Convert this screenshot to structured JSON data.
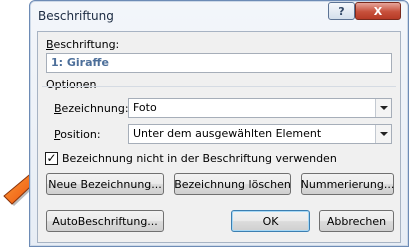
{
  "window": {
    "title": "Beschriftung",
    "help_label": "?",
    "close_label": "X"
  },
  "caption": {
    "label": "Beschriftung:",
    "value": "1: Giraffe"
  },
  "options": {
    "group_label": "Optionen",
    "bezeichnung": {
      "label": "Bezeichnung:",
      "value": "Foto"
    },
    "position": {
      "label": "Position:",
      "value": "Unter dem ausgewählten Element"
    },
    "exclude_label": {
      "label": "Bezeichnung nicht in der Beschriftung verwenden",
      "checked": true,
      "check_glyph": "✓"
    }
  },
  "buttons": {
    "new_label": "Neue Bezeichnung...",
    "delete_label": "Bezeichnung löschen",
    "numbering": "Nummerierung...",
    "autocaption": "AutoBeschriftung...",
    "ok": "OK",
    "cancel": "Abbrechen"
  },
  "colors": {
    "pointer_arrow": "#f26a1b",
    "caption_text": "#4d6f9a"
  }
}
